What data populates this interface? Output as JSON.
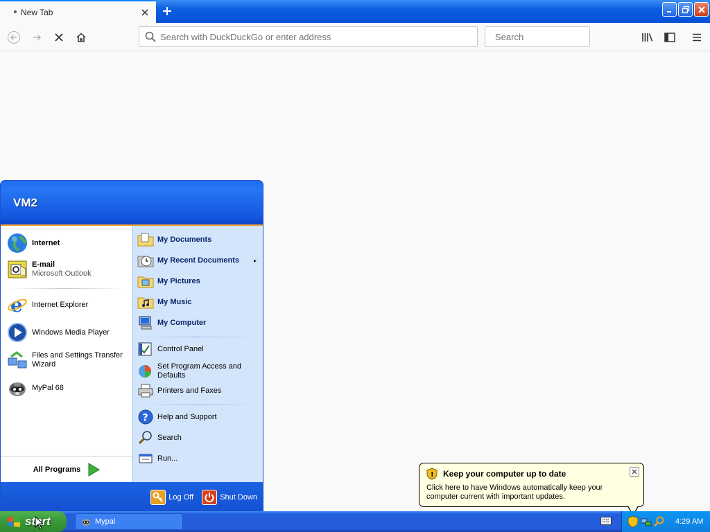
{
  "browser": {
    "tab": {
      "title": "New Tab",
      "close_icon": "close-icon"
    },
    "new_tab_icon": "plus-icon",
    "window_controls": [
      "minimize-icon",
      "restore-icon",
      "close-icon"
    ],
    "nav": {
      "back_icon": "arrow-left-icon",
      "forward_icon": "arrow-right-icon",
      "stop_icon": "x-icon",
      "home_icon": "home-icon",
      "library_icon": "library-icon",
      "sidebar_icon": "sidebar-icon",
      "menu_icon": "hamburger-icon"
    },
    "urlbar": {
      "placeholder": "Search with DuckDuckGo or enter address",
      "value": ""
    },
    "searchbar": {
      "placeholder": "Search",
      "value": ""
    }
  },
  "start_menu": {
    "user": "VM2",
    "pinned": [
      {
        "label": "Internet",
        "icon": "globe-icon"
      },
      {
        "label": "E-mail",
        "sub": "Microsoft Outlook",
        "icon": "outlook-icon"
      }
    ],
    "recent": [
      {
        "label": "Internet Explorer",
        "icon": "ie-icon"
      },
      {
        "label": "Windows Media Player",
        "icon": "media-player-icon"
      },
      {
        "label": "Files and Settings Transfer",
        "label2": "Wizard",
        "icon": "transfer-wizard-icon"
      },
      {
        "label": "MyPal 68",
        "icon": "mypal-icon"
      }
    ],
    "all_programs": "All Programs",
    "places": [
      {
        "label": "My Documents",
        "icon": "folder-documents-icon"
      },
      {
        "label": "My Recent Documents",
        "icon": "recent-documents-icon",
        "arrow": "▸"
      },
      {
        "label": "My Pictures",
        "icon": "folder-pictures-icon"
      },
      {
        "label": "My Music",
        "icon": "folder-music-icon"
      },
      {
        "label": "My Computer",
        "icon": "computer-icon"
      }
    ],
    "system": [
      {
        "label": "Control Panel",
        "icon": "control-panel-icon"
      },
      {
        "label": "Set Program Access and",
        "label2": "Defaults",
        "icon": "program-access-icon"
      },
      {
        "label": "Printers and Faxes",
        "icon": "printer-icon"
      }
    ],
    "tools": [
      {
        "label": "Help and Support",
        "icon": "help-icon"
      },
      {
        "label": "Search",
        "icon": "search-icon"
      },
      {
        "label": "Run...",
        "icon": "run-icon"
      }
    ],
    "footer": {
      "logoff": "Log Off",
      "shutdown": "Shut Down"
    }
  },
  "taskbar": {
    "start_label": "start",
    "task": "Mypal",
    "clock": "4:29 AM"
  },
  "balloon": {
    "title": "Keep your computer up to date",
    "body": "Click here to have Windows automatically keep your computer current with important updates."
  }
}
